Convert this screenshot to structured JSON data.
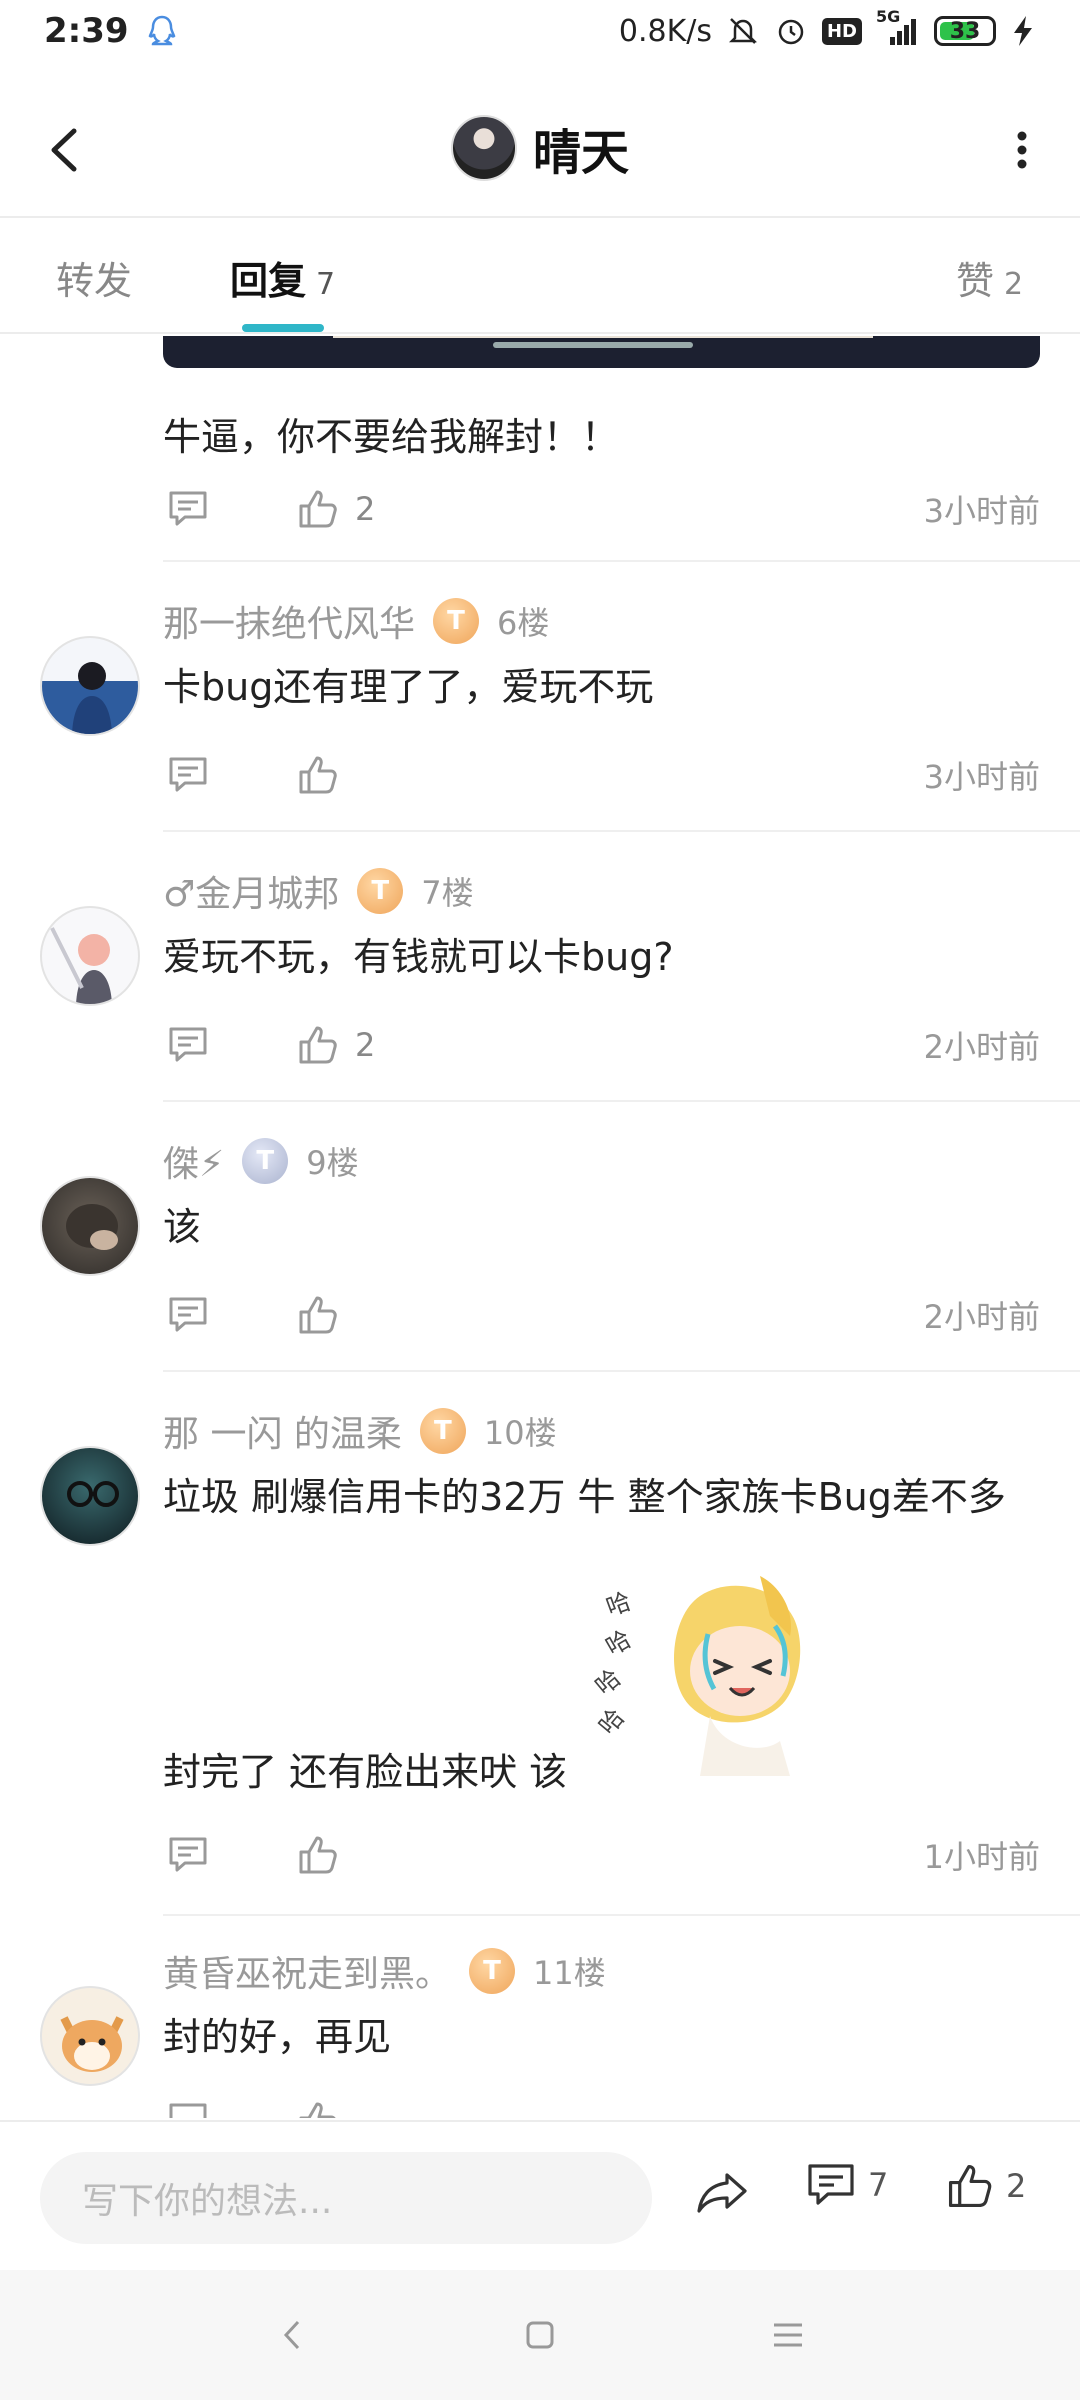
{
  "status_bar": {
    "time": "2:39",
    "net_speed": "0.8K/s",
    "hd_label": "HD",
    "signal_label": "5G",
    "battery": "33"
  },
  "header": {
    "title": "晴天"
  },
  "tabs": [
    {
      "label": "转发",
      "count": ""
    },
    {
      "label": "回复",
      "count": "7"
    },
    {
      "label": "赞",
      "count": "2"
    }
  ],
  "first_reply": {
    "text": "牛逼，你不要给我解封！！",
    "likes": "2",
    "time": "3小时前"
  },
  "comments": [
    {
      "name": "那一抹绝代风华",
      "level": "T",
      "floor": "6楼",
      "text": "卡bug还有理了了，爱玩不玩",
      "likes": "",
      "time": "3小时前"
    },
    {
      "name": "♂金月城邦",
      "level": "T",
      "floor": "7楼",
      "text": "爱玩不玩，有钱就可以卡bug?",
      "likes": "2",
      "time": "2小时前"
    },
    {
      "name": "傑⚡",
      "level": "T",
      "floor": "9楼",
      "text": "该",
      "likes": "",
      "time": "2小时前"
    },
    {
      "name": "那 一闪 的温柔",
      "level": "T",
      "floor": "10楼",
      "text": "垃圾 刷爆信用卡的32万 牛 整个家族卡Bug差不多",
      "text2": "封完了 还有脸出来吠 该",
      "likes": "",
      "time": "1小时前"
    },
    {
      "name": "黄昏巫祝走到黑。",
      "level": "T",
      "floor": "11楼",
      "text": "封的好，再见",
      "likes": "",
      "time": ""
    }
  ],
  "bottom_bar": {
    "placeholder": "写下你的想法...",
    "comment_count": "7",
    "like_count": "2"
  },
  "colors": {
    "accent": "#2fb6c8",
    "badge_gold": "#efa55a",
    "badge_silver": "#aab3cf"
  }
}
